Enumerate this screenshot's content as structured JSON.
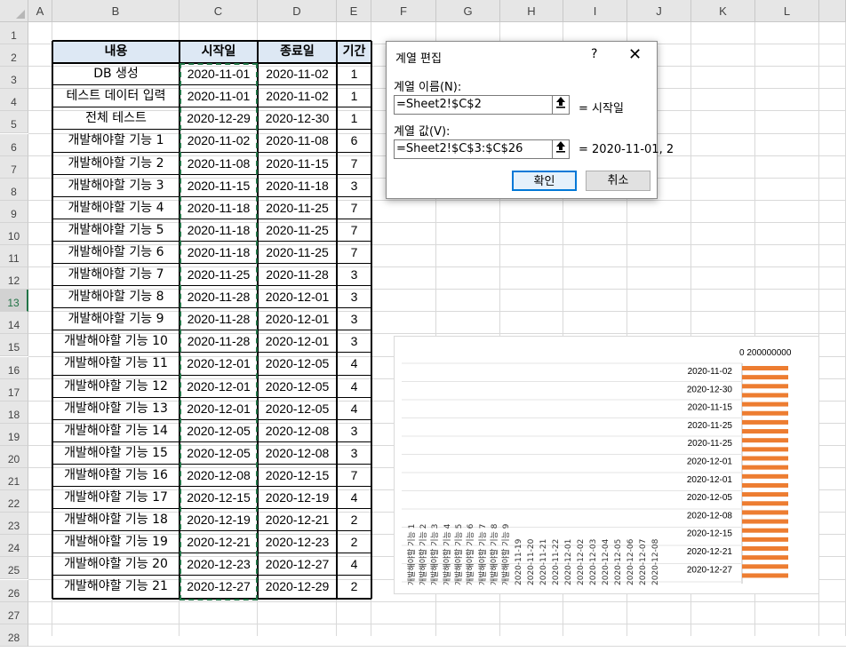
{
  "spreadsheet": {
    "columns": [
      "A",
      "B",
      "C",
      "D",
      "E",
      "F",
      "G",
      "H",
      "I",
      "J",
      "K",
      "L"
    ],
    "rows": [
      "1",
      "2",
      "3",
      "4",
      "5",
      "6",
      "7",
      "8",
      "9",
      "10",
      "11",
      "12",
      "13",
      "14",
      "15",
      "16",
      "17",
      "18",
      "19",
      "20",
      "21",
      "22",
      "23",
      "24",
      "25",
      "26",
      "27",
      "28"
    ],
    "selected_row": "13",
    "table": {
      "headers": [
        "내용",
        "시작일",
        "종료일",
        "기간"
      ],
      "rows": [
        [
          "DB 생성",
          "2020-11-01",
          "2020-11-02",
          "1"
        ],
        [
          "테스트 데이터 입력",
          "2020-11-01",
          "2020-11-02",
          "1"
        ],
        [
          "전체 테스트",
          "2020-12-29",
          "2020-12-30",
          "1"
        ],
        [
          "개발해야할 기능 1",
          "2020-11-02",
          "2020-11-08",
          "6"
        ],
        [
          "개발해야할 기능 2",
          "2020-11-08",
          "2020-11-15",
          "7"
        ],
        [
          "개발해야할 기능 3",
          "2020-11-15",
          "2020-11-18",
          "3"
        ],
        [
          "개발해야할 기능 4",
          "2020-11-18",
          "2020-11-25",
          "7"
        ],
        [
          "개발해야할 기능 5",
          "2020-11-18",
          "2020-11-25",
          "7"
        ],
        [
          "개발해야할 기능 6",
          "2020-11-18",
          "2020-11-25",
          "7"
        ],
        [
          "개발해야할 기능 7",
          "2020-11-25",
          "2020-11-28",
          "3"
        ],
        [
          "개발해야할 기능 8",
          "2020-11-28",
          "2020-12-01",
          "3"
        ],
        [
          "개발해야할 기능 9",
          "2020-11-28",
          "2020-12-01",
          "3"
        ],
        [
          "개발해야할 기능 10",
          "2020-11-28",
          "2020-12-01",
          "3"
        ],
        [
          "개발해야할 기능 11",
          "2020-12-01",
          "2020-12-05",
          "4"
        ],
        [
          "개발해야할 기능 12",
          "2020-12-01",
          "2020-12-05",
          "4"
        ],
        [
          "개발해야할 기능 13",
          "2020-12-01",
          "2020-12-05",
          "4"
        ],
        [
          "개발해야할 기능 14",
          "2020-12-05",
          "2020-12-08",
          "3"
        ],
        [
          "개발해야할 기능 15",
          "2020-12-05",
          "2020-12-08",
          "3"
        ],
        [
          "개발해야할 기능 16",
          "2020-12-08",
          "2020-12-15",
          "7"
        ],
        [
          "개발해야할 기능 17",
          "2020-12-15",
          "2020-12-19",
          "4"
        ],
        [
          "개발해야할 기능 18",
          "2020-12-19",
          "2020-12-21",
          "2"
        ],
        [
          "개발해야할 기능 19",
          "2020-12-21",
          "2020-12-23",
          "2"
        ],
        [
          "개발해야할 기능 20",
          "2020-12-23",
          "2020-12-27",
          "4"
        ],
        [
          "개발해야할 기능 21",
          "2020-12-27",
          "2020-12-29",
          "2"
        ]
      ]
    }
  },
  "dialog": {
    "title": "계열 편집",
    "help": "?",
    "close": "✕",
    "series_name_label": "계열 이름(N):",
    "series_name_value": "=Sheet2!$C$2",
    "series_name_preview": "= 시작일",
    "series_values_label": "계열 값(V):",
    "series_values_value": "=Sheet2!$C$3:$C$26",
    "series_values_preview": "= 2020-11-01, 2",
    "ok_label": "확인",
    "cancel_label": "취소",
    "range_button_icon": "collapse-range-icon"
  },
  "chart_data": {
    "type": "bar",
    "axis_top_label": "0  200000000",
    "date_labels": [
      "2020-11-02",
      "2020-12-30",
      "2020-11-15",
      "2020-11-25",
      "2020-11-25",
      "2020-12-01",
      "2020-12-01",
      "2020-12-05",
      "2020-12-08",
      "2020-12-15",
      "2020-12-21",
      "2020-12-27"
    ],
    "bar_color": "#ed7d31",
    "bar_count": 24
  }
}
